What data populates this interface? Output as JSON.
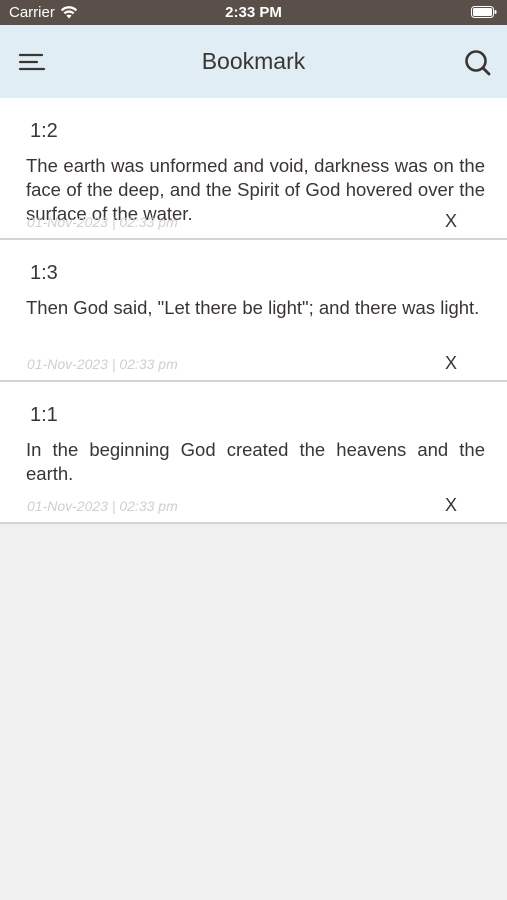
{
  "status_bar": {
    "carrier": "Carrier",
    "time": "2:33 PM"
  },
  "nav": {
    "title": "Bookmark",
    "left_icon": "hamburger-menu-icon",
    "right_icon": "search-icon"
  },
  "colors": {
    "status_bar_bg": "#5a4f49",
    "nav_bg": "#e1edf5",
    "page_bg": "#f0f0f0",
    "text": "#3a3533",
    "timestamp": "#cfcfcf"
  },
  "bookmarks": [
    {
      "ref": "1:2",
      "text": "The earth was unformed and void, darkness was on the face of the deep, and the Spirit of God hovered over the surface of the water.",
      "timestamp": "01-Nov-2023 | 02:33 pm",
      "delete_label": "X"
    },
    {
      "ref": "1:3",
      "text": "Then God said, \"Let there be light\"; and there was light.",
      "timestamp": "01-Nov-2023 | 02:33 pm",
      "delete_label": "X"
    },
    {
      "ref": "1:1",
      "text": "In the beginning God created the heavens and the earth.",
      "timestamp": "01-Nov-2023 | 02:33 pm",
      "delete_label": "X"
    }
  ]
}
